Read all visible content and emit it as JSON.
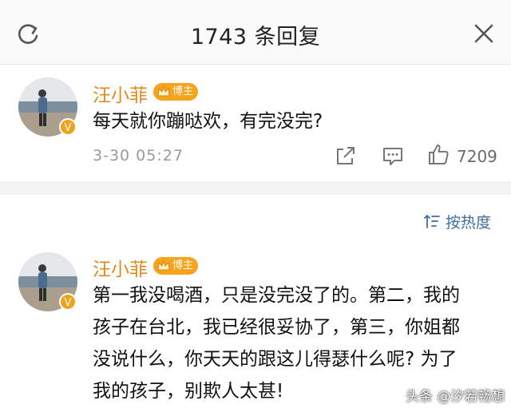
{
  "header": {
    "title": "1743 条回复",
    "refresh_icon": "refresh-icon",
    "close_icon": "close-icon"
  },
  "colors": {
    "name": "#e08a1e",
    "badge": "#f7a41c",
    "link": "#3f6d9c",
    "meta": "#9a9a9a",
    "divider_band": "#f3f3f3"
  },
  "comment": {
    "author": "汪小菲",
    "badge": "博主",
    "text": "每天就你蹦哒欢，有完没完?",
    "time": "3-30 05:27",
    "likes": "7209",
    "icons": [
      "share-icon",
      "comment-icon",
      "like-icon"
    ]
  },
  "sort": {
    "label": "按热度",
    "icon": "sort-icon"
  },
  "reply": {
    "author": "汪小菲",
    "badge": "博主",
    "lines": [
      "第一我没喝酒，只是没完没了的。第二，我的",
      "孩子在台北，我已经很妥协了，第三，你姐都",
      "没说什么，你天天的跟这儿得瑟什么呢? 为了",
      "我的孩子，别欺人太甚!"
    ]
  },
  "watermark": "头条 @汐若畅想"
}
